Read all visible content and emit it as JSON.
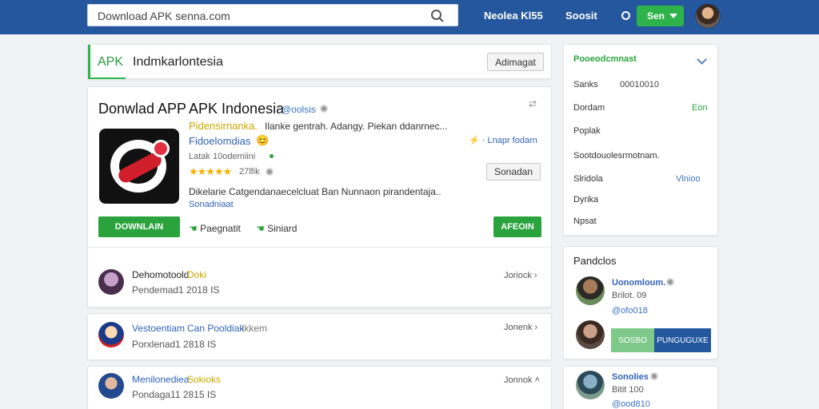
{
  "topbar": {
    "search_value": "Download APK senna.com",
    "link1": "Neolea Kl55",
    "link2": "Soosit",
    "btn": "Sen"
  },
  "crumb": {
    "apk": "APK",
    "title": "Indmkarlontesia",
    "button": "Adimagat"
  },
  "app": {
    "title_left": "Donwlad APP",
    "title_right": "APK Indonesia",
    "verified": "@oolsis",
    "tagline_yellow": "Pidensirnanka.",
    "tagline_rest": "Ilanke gentrah. Adangy.  Piekan ddanrnec...",
    "developer": "Fidoelomdias",
    "developer_emoji": "😊",
    "link_right": "⚡ · Lnapr fodarn",
    "subinfo": "Latak 10odemiini",
    "rating_count": "27lfik",
    "stars": "★★★★★",
    "side_button": "Sonadan",
    "desc": "Dikelarie  Catgendanaecelcluat  Ban  Nunnaon  pirandentaja..",
    "desc_link": "Sonadniaat",
    "download_btn": "DOWNLAIN",
    "action1": "Paegnatit",
    "action2": "Siniard",
    "right_btn": "AFEOIN"
  },
  "list": [
    {
      "name": "Dehomotoold",
      "tag": "Doki",
      "meta": "Pendemad1  2018 IS",
      "action": "Joriock"
    },
    {
      "name": "Vestoentiam",
      "name2": "Can Pooldiak",
      "tag": "Ikkem",
      "meta": "Porxlenad1  2818 IS",
      "action": "Jonenk"
    },
    {
      "name": "Menilonediea",
      "tag": "Sokioks",
      "meta": "Pondaga11  2815 IS",
      "action": "Jonnok"
    }
  ],
  "side_info": {
    "header": "Pooeodcmnast",
    "rows": [
      {
        "label": "Sanks",
        "value": "00010010"
      },
      {
        "label": "Dordam",
        "value": "Eon"
      },
      {
        "label": "Poplak",
        "value": ""
      },
      {
        "label": "Sootdouolesrmotnam.",
        "value": ""
      },
      {
        "label": "Slridola",
        "value": "Vlnioo"
      },
      {
        "label": "Dyrika",
        "value": ""
      },
      {
        "label": "Npsat",
        "value": ""
      }
    ]
  },
  "side_people": {
    "title": "Pandclos",
    "p1_name": "Uonomloum.",
    "p1_meta": "Brilot. 09",
    "p1_meta2": "@ofo018",
    "seg1": "SOSBO",
    "seg2": "PUNGUGUXE",
    "p3_name": "Sonolies",
    "p3_meta": "Bitit 100",
    "p3_meta2": "@ood810"
  }
}
